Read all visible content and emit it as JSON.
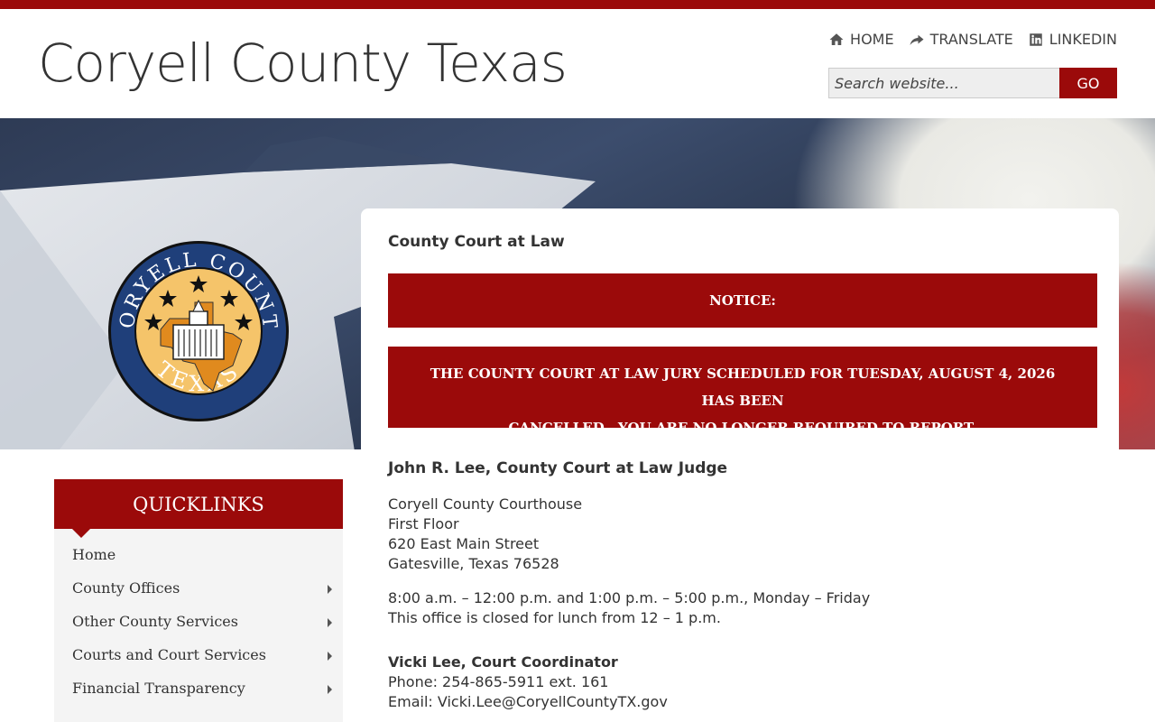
{
  "site": {
    "title": "Coryell County Texas"
  },
  "top_nav": [
    {
      "label": "HOME",
      "icon": "home-icon"
    },
    {
      "label": "TRANSLATE",
      "icon": "share-arrow-icon"
    },
    {
      "label": "LINKEDIN",
      "icon": "linkedin-icon"
    }
  ],
  "search": {
    "placeholder": "Search website...",
    "button_label": "GO"
  },
  "seal": {
    "top_text": "CORYELL COUNTY",
    "bottom_text": "TEXAS"
  },
  "page": {
    "heading": "County Court at Law",
    "notice_title": "NOTICE:",
    "notice_line_1": "THE COUNTY COURT AT LAW JURY SCHEDULED FOR TUESDAY, AUGUST 4, 2026 HAS BEEN",
    "notice_line_2": "CANCELLED.  YOU ARE NO LONGER REQUIRED TO REPORT.",
    "judge": "John R. Lee, County Court at Law Judge",
    "address": [
      "Coryell County Courthouse",
      "First Floor",
      "620 East Main Street",
      "Gatesville, Texas 76528"
    ],
    "hours": [
      "8:00 a.m. – 12:00 p.m. and 1:00 p.m. – 5:00 p.m., Monday – Friday",
      "This office is closed for lunch from 12 – 1 p.m."
    ],
    "coordinator": {
      "name": "Vicki Lee, Court Coordinator",
      "phone": "Phone: 254-865-5911 ext. 161",
      "email": "Email: Vicki.Lee@CoryellCountyTX.gov"
    }
  },
  "quicklinks": {
    "title": "QUICKLINKS",
    "items": [
      {
        "label": "Home",
        "has_submenu": false
      },
      {
        "label": "County Offices",
        "has_submenu": true
      },
      {
        "label": "Other County Services",
        "has_submenu": true
      },
      {
        "label": "Courts and Court Services",
        "has_submenu": true
      },
      {
        "label": "Financial Transparency",
        "has_submenu": true
      }
    ]
  },
  "colors": {
    "brand_red": "#9b0a0a",
    "seal_blue": "#1f3f7a",
    "seal_gold": "#f5c46a"
  }
}
